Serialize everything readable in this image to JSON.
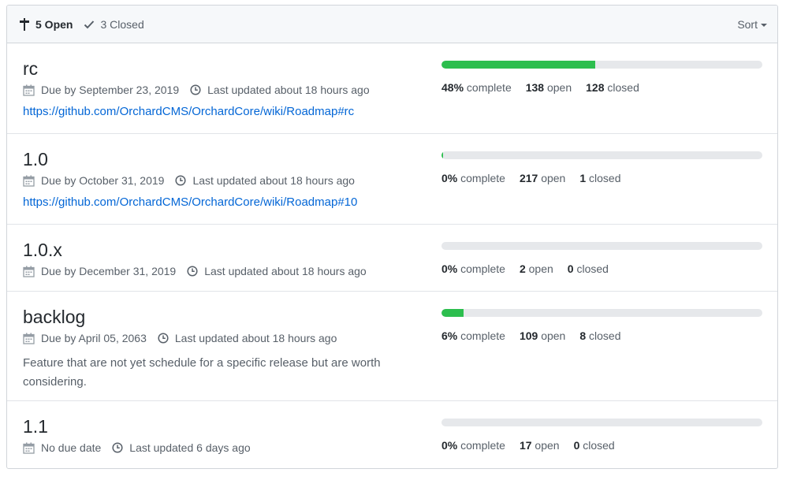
{
  "header": {
    "open_label": "5 Open",
    "closed_label": "3 Closed",
    "sort_label": "Sort"
  },
  "milestones": [
    {
      "title": "rc",
      "due": "Due by September 23, 2019",
      "updated": "Last updated about 18 hours ago",
      "link": "https://github.com/OrchardCMS/OrchardCore/wiki/Roadmap#rc",
      "description": "",
      "progress": 48,
      "percent_num": "48%",
      "percent_word": "complete",
      "open_num": "138",
      "open_word": "open",
      "closed_num": "128",
      "closed_word": "closed"
    },
    {
      "title": "1.0",
      "due": "Due by October 31, 2019",
      "updated": "Last updated about 18 hours ago",
      "link": "https://github.com/OrchardCMS/OrchardCore/wiki/Roadmap#10",
      "description": "",
      "progress": 0.5,
      "percent_num": "0%",
      "percent_word": "complete",
      "open_num": "217",
      "open_word": "open",
      "closed_num": "1",
      "closed_word": "closed"
    },
    {
      "title": "1.0.x",
      "due": "Due by December 31, 2019",
      "updated": "Last updated about 18 hours ago",
      "link": "",
      "description": "",
      "progress": 0,
      "percent_num": "0%",
      "percent_word": "complete",
      "open_num": "2",
      "open_word": "open",
      "closed_num": "0",
      "closed_word": "closed"
    },
    {
      "title": "backlog",
      "due": "Due by April 05, 2063",
      "updated": "Last updated about 18 hours ago",
      "link": "",
      "description": "Feature that are not yet schedule for a specific release but are worth considering.",
      "progress": 7,
      "percent_num": "6%",
      "percent_word": "complete",
      "open_num": "109",
      "open_word": "open",
      "closed_num": "8",
      "closed_word": "closed"
    },
    {
      "title": "1.1",
      "due": "No due date",
      "updated": "Last updated 6 days ago",
      "link": "",
      "description": "",
      "progress": 0,
      "percent_num": "0%",
      "percent_word": "complete",
      "open_num": "17",
      "open_word": "open",
      "closed_num": "0",
      "closed_word": "closed"
    }
  ],
  "colors": {
    "progress_fill": "#2cbe4e",
    "progress_track": "#e6e8eb",
    "link": "#0366d6"
  }
}
